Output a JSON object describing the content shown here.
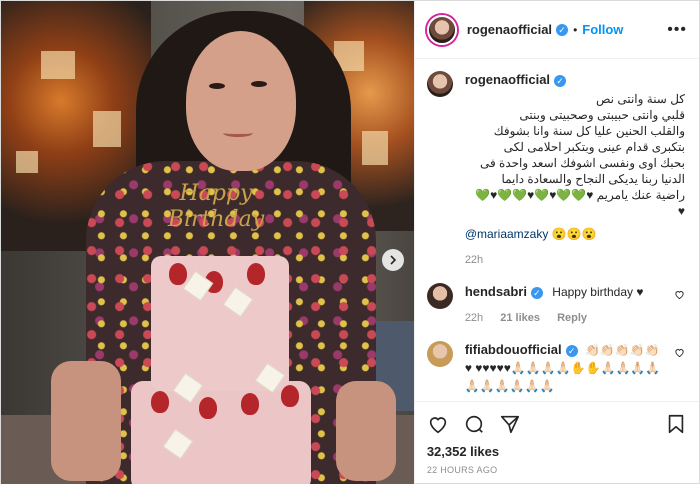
{
  "post": {
    "username": "rogenaofficial",
    "follow_label": "Follow",
    "more_label": "•••",
    "topper_text": "Happy Birthday"
  },
  "caption": {
    "username": "rogenaofficial",
    "text": "كل سنة وانتى نص\nقلبي وانتى حبيبتى وصحبيتى وبنتى\nوالقلب الحنين عليا كل سنة وانا بشوفك\nبتكبرى قدام عينى وبتكبر احلامى لكى\nبحبك اوى ونفسى اشوفك اسعد واحدة فى\nالدنيا ربنا يديكى النجاح والسعادة دايما\nراضية عنك يامريم ♥💚💚♥💚♥💚💚♥💚\n♥",
    "mention": "@mariaamzaky",
    "mention_emoji": "😮😮😮",
    "time": "22h"
  },
  "comments": [
    {
      "username": "hendsabri",
      "text": "Happy birthday ♥",
      "time": "22h",
      "likes": "21 likes",
      "reply": "Reply"
    },
    {
      "username": "fifiabdouofficial",
      "text": "👏🏻👏🏻👏🏻👏🏻👏🏻♥ ♥♥♥♥♥🙏🏻🙏🏻🙏🏻🙏🏻✋✋🙏🏻🙏🏻🙏🏻🙏🏻🙏🏻🙏🏻🙏🏻🙏🏻🙏🏻🙏🏻",
      "time": "",
      "likes": "",
      "reply": ""
    }
  ],
  "footer": {
    "likes": "32,352 likes",
    "ago": "22 HOURS AGO"
  },
  "icons": {
    "like": "heart-icon",
    "comment": "comment-icon",
    "share": "share-icon",
    "save": "bookmark-icon",
    "next": "chevron-right-icon"
  },
  "colors": {
    "accent": "#0095f6",
    "verified": "#3897f0",
    "muted": "#8e8e8e"
  }
}
